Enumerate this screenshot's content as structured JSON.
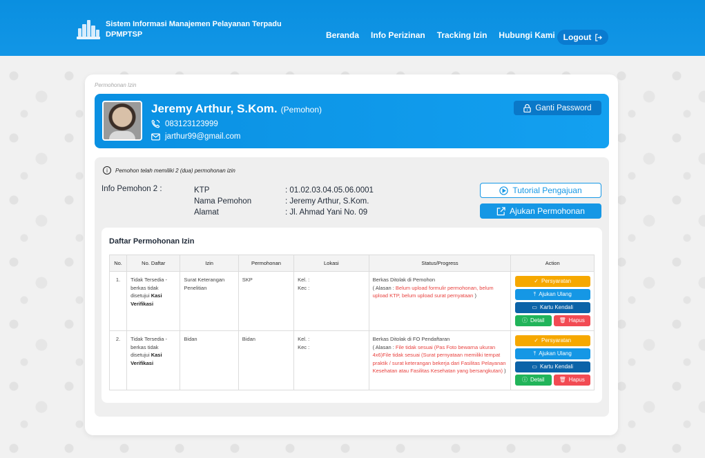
{
  "brand": {
    "title": "Sistem Informasi Manajemen Pelayanan Terpadu",
    "subtitle": "DPMPTSP"
  },
  "nav": {
    "items": [
      "Beranda",
      "Info Perizinan",
      "Tracking Izin",
      "Hubungi Kami"
    ],
    "logout": "Logout"
  },
  "breadcrumb": "Permohonan Izin",
  "profile": {
    "name": "Jeremy Arthur, S.Kom.",
    "role": "(Pemohon)",
    "phone": "083123123999",
    "email": "jarthur99@gmail.com",
    "change_password": "Ganti Password"
  },
  "notice": "Pemohon telah memiliki 2 (dua) permohonan izin",
  "info": {
    "title": "Info Pemohon 2 :",
    "rows": [
      {
        "key": "KTP",
        "value": ": 01.02.03.04.05.06.0001"
      },
      {
        "key": "Nama Pemohon",
        "value": ": Jeremy Arthur, S.Kom."
      },
      {
        "key": "Alamat",
        "value": ": Jl. Ahmad Yani No. 09"
      }
    ],
    "tutorial_button": "Tutorial Pengajuan",
    "submit_button": "Ajukan Permohonan"
  },
  "list": {
    "title": "Daftar Permohonan Izin",
    "headers": [
      "No.",
      "No. Daftar",
      "Izin",
      "Permohonan",
      "Lokasi",
      "Status/Progress",
      "Action"
    ],
    "rows": [
      {
        "no": "1.",
        "daftar_a": "Tidak Tersedia - berkas tidak disetujui",
        "daftar_b": "Kasi Verifikasi",
        "izin": "Surat Keterangan Penelitian",
        "permohonan": "SKP",
        "lokasi_kel": "Kel. :",
        "lokasi_kec": "Kec :",
        "status": "Berkas Ditolak di Pemohon",
        "alasan_prefix": "( Alasan : ",
        "alasan": "Belum upload formulir permohonan, belum upload KTP, belum upload surat pernyataan",
        "alasan_suffix": " )"
      },
      {
        "no": "2.",
        "daftar_a": "Tidak Tersedia - berkas tidak disetujui",
        "daftar_b": "Kasi Verifikasi",
        "izin": "Bidan",
        "permohonan": "Bidan",
        "lokasi_kel": "Kel. :",
        "lokasi_kec": "Kec :",
        "status": "Berkas Ditolak di FO Pendaftaran",
        "alasan_prefix": "( Alasan : ",
        "alasan": "File tidak sesuai (Pas Foto bewarna ukuran 4x6)File tidak sesuai (Surat pernyataan memiliki tempat praktik / surat keterangan bekerja dari Fasilitas Pelayanan Kesehatan atau Fasilitas Kesehatan yang bersangkutan)",
        "alasan_suffix": " )"
      }
    ],
    "actions": {
      "persyaratan": "Persyaratan",
      "ajukan_ulang": "Ajukan Ulang",
      "kartu_kendali": "Kartu Kendali",
      "detail": "Detail",
      "hapus": "Hapus"
    }
  }
}
